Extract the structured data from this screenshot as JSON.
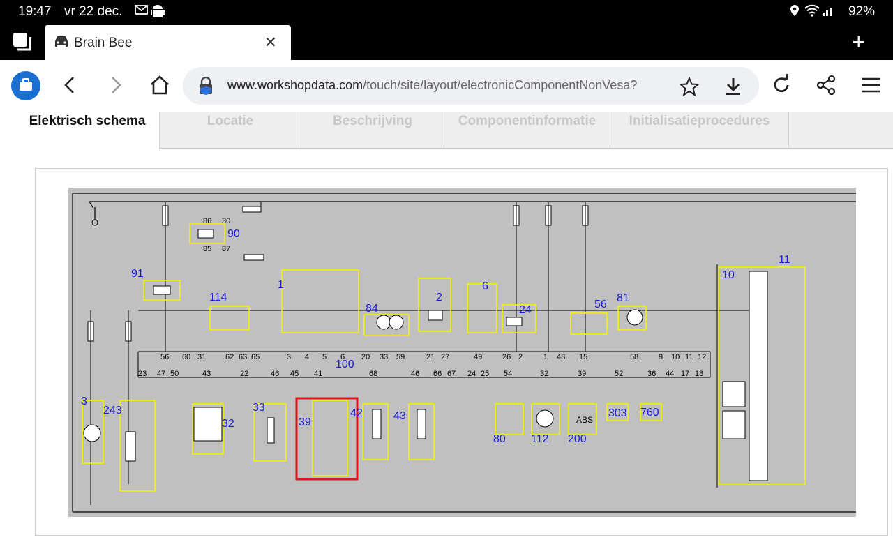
{
  "status_bar": {
    "time": "19:47",
    "date": "vr 22 dec.",
    "battery": "92%",
    "icons": [
      "mail-icon",
      "android-icon",
      "location-icon",
      "wifi-icon",
      "signal-icon",
      "battery-icon"
    ]
  },
  "browser": {
    "tab_title": "Brain Bee",
    "url_host": "www.workshopdata.com",
    "url_path": "/touch/site/layout/electronicComponentNonVesa?"
  },
  "page_tabs": [
    {
      "label": "Elektrisch schema",
      "active": true
    },
    {
      "label": "Locatie",
      "active": false
    },
    {
      "label": "Beschrijving",
      "active": false
    },
    {
      "label": "Componentinformatie",
      "active": false
    },
    {
      "label": "Initialisatieprocedures",
      "active": false
    }
  ],
  "schema": {
    "component_numbers": [
      "90",
      "91",
      "114",
      "1",
      "84",
      "2",
      "6",
      "24",
      "56",
      "81",
      "10",
      "11",
      "100",
      "3",
      "243",
      "32",
      "33",
      "39",
      "42",
      "43",
      "80",
      "112",
      "200",
      "303",
      "760"
    ],
    "bus_pins_top": [
      "56",
      "60",
      "31",
      "62",
      "63",
      "65",
      "3",
      "4",
      "5",
      "6",
      "20",
      "33",
      "59",
      "21",
      "27",
      "49",
      "26",
      "2",
      "1",
      "48",
      "15",
      "58",
      "9",
      "10",
      "11",
      "12"
    ],
    "bus_pins_bottom": [
      "23",
      "47",
      "50",
      "43",
      "22",
      "46",
      "45",
      "41",
      "68",
      "46",
      "66",
      "67",
      "24",
      "25",
      "54",
      "32",
      "39",
      "52",
      "36",
      "44",
      "17",
      "18"
    ],
    "relay_pins": [
      "86",
      "30",
      "85",
      "87"
    ],
    "abs_label": "ABS",
    "highlight_color": "#e0141e",
    "component_outline_color": "#f2f200",
    "component_label_color": "#1a1ad8"
  }
}
